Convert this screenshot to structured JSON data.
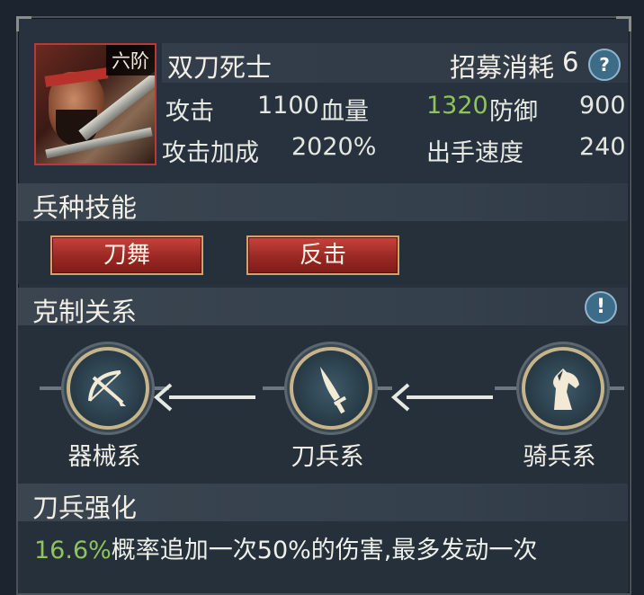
{
  "unit": {
    "rank": "六阶",
    "name": "双刀死士",
    "recruit_cost_label": "招募消耗",
    "recruit_cost_value": "6",
    "help_icon": "question-icon"
  },
  "stats": {
    "attack_label": "攻击",
    "attack_value": "1100",
    "hp_label": "血量",
    "hp_value": "1320",
    "defense_label": "防御",
    "defense_value": "900",
    "attack_bonus_label": "攻击加成",
    "attack_bonus_value": "2020%",
    "speed_label": "出手速度",
    "speed_value": "240"
  },
  "skills": {
    "title": "兵种技能",
    "items": [
      "刀舞",
      "反击"
    ]
  },
  "counter": {
    "title": "克制关系",
    "info_icon": "exclamation-icon",
    "nodes": [
      {
        "label": "器械系",
        "icon": "crossbow-icon"
      },
      {
        "label": "刀兵系",
        "icon": "saber-icon"
      },
      {
        "label": "骑兵系",
        "icon": "horse-icon"
      }
    ]
  },
  "enhance": {
    "title": "刀兵强化",
    "percent": "16.6%",
    "text": "概率追加一次50%的伤害,最多发动一次"
  },
  "colors": {
    "green": "#8fc45c",
    "button_red": "#9a2824",
    "ring_gold": "#c6b58a"
  }
}
